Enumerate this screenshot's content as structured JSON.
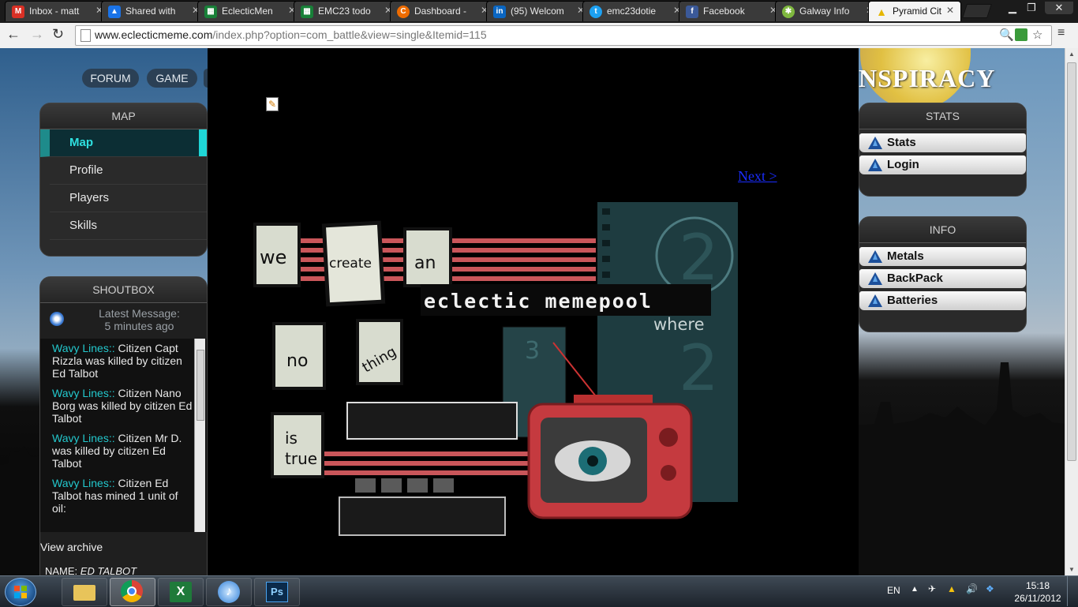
{
  "browser": {
    "tabs": [
      {
        "label": "Inbox - matt",
        "icon": "gmail-icon",
        "color": "#d93025"
      },
      {
        "label": "Shared with",
        "icon": "drive-icon",
        "color": "#1a73e8"
      },
      {
        "label": "EclecticMen",
        "icon": "sheets-icon",
        "color": "#188038"
      },
      {
        "label": "EMC23 todo",
        "icon": "sheets-icon",
        "color": "#188038"
      },
      {
        "label": "Dashboard -",
        "icon": "dashboard-icon",
        "color": "#ef6c00"
      },
      {
        "label": "(95) Welcom",
        "icon": "linkedin-icon",
        "color": "#0a66c2"
      },
      {
        "label": "emc23dotie",
        "icon": "twitter-icon",
        "color": "#1da1f2"
      },
      {
        "label": "Facebook",
        "icon": "facebook-icon",
        "color": "#3b5998"
      },
      {
        "label": "Galway Info",
        "icon": "joomla-icon",
        "color": "#7fb83f"
      },
      {
        "label": "Pyramid Cit",
        "icon": "warning-icon",
        "color": "#e5b700"
      }
    ],
    "url_host": "www.eclecticmeme.com",
    "url_path": "/index.php?option=com_battle&view=single&Itemid=115"
  },
  "page": {
    "top_nav": [
      "FORUM",
      "GAME"
    ],
    "logo_text": "NSPIRACY",
    "map_module": {
      "title": "MAP",
      "items": [
        "Map",
        "Profile",
        "Players",
        "Skills"
      ]
    },
    "shoutbox": {
      "title": "SHOUTBOX",
      "latest_label": "Latest Message:",
      "latest_time": "5 minutes ago",
      "messages": [
        {
          "user": "Wavy Lines::",
          "text": "Citizen Capt Rizzla was killed by citizen Ed Talbot"
        },
        {
          "user": "Wavy Lines::",
          "text": "Citizen Nano Borg was killed by citizen Ed Talbot"
        },
        {
          "user": "Wavy Lines::",
          "text": "Citizen Mr D. was killed by citizen Ed Talbot"
        },
        {
          "user": "Wavy Lines::",
          "text": "Citizen Ed Talbot has mined 1 unit of oil:"
        }
      ],
      "archive_link": "View archive",
      "name_label": "NAME:",
      "name_value": "ED TALBOT"
    },
    "next_link": "Next >",
    "banner": {
      "words": [
        "we",
        "create",
        "an",
        "no",
        "thing",
        "is",
        "true"
      ],
      "headline": "eclectic memepool",
      "sub": "where",
      "frame_number": "2",
      "frame_number_small": "3"
    },
    "stats_module": {
      "title": "STATS",
      "items": [
        "Stats",
        "Login"
      ]
    },
    "info_module": {
      "title": "INFO",
      "items": [
        "Metals",
        "BackPack",
        "Batteries"
      ]
    }
  },
  "taskbar": {
    "apps": [
      "windows-explorer-icon",
      "chrome-icon",
      "excel-icon",
      "itunes-icon",
      "photoshop-icon"
    ],
    "language": "EN",
    "time": "15:18",
    "date": "26/11/2012"
  }
}
